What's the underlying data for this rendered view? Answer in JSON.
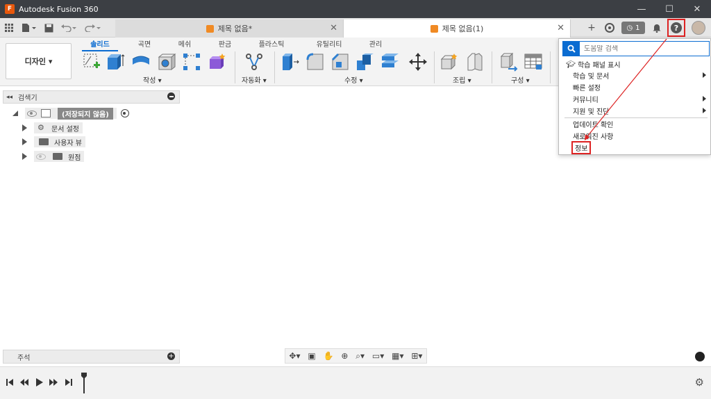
{
  "app": {
    "title": "Autodesk Fusion 360",
    "logo_letter": "F"
  },
  "window_controls": {
    "minimize": "—",
    "maximize": "☐",
    "close": "✕"
  },
  "tabs": [
    {
      "label": "제목 없음*"
    },
    {
      "label": "제목 없음(1)"
    }
  ],
  "toolbar": {
    "job_count": "1"
  },
  "ribbon": {
    "workspace": "디자인 ▾",
    "tabs": [
      "솔리드",
      "곡면",
      "메쉬",
      "판금",
      "플라스틱",
      "유틸리티",
      "관리"
    ],
    "groups": [
      "작성 ▾",
      "자동화 ▾",
      "수정 ▾",
      "조립 ▾",
      "구성 ▾"
    ]
  },
  "browser": {
    "title": "검색기",
    "root_label": "(저장되지 않음)",
    "items": [
      "문서 설정",
      "사용자 뷰",
      "원점"
    ]
  },
  "comments": {
    "label": "주석"
  },
  "help_menu": {
    "search_placeholder": "도움말 검색",
    "items": [
      "학습 패널 표시",
      "학습 및 문서",
      "빠른 설정",
      "커뮤니티",
      "지원 및 진단"
    ],
    "items2": [
      "업데이트 확인",
      "새로워진 사항",
      "정보"
    ]
  },
  "colors": {
    "accent": "#0b6cd1",
    "highlight": "#dd2222",
    "title_bar": "#3c3f44"
  }
}
